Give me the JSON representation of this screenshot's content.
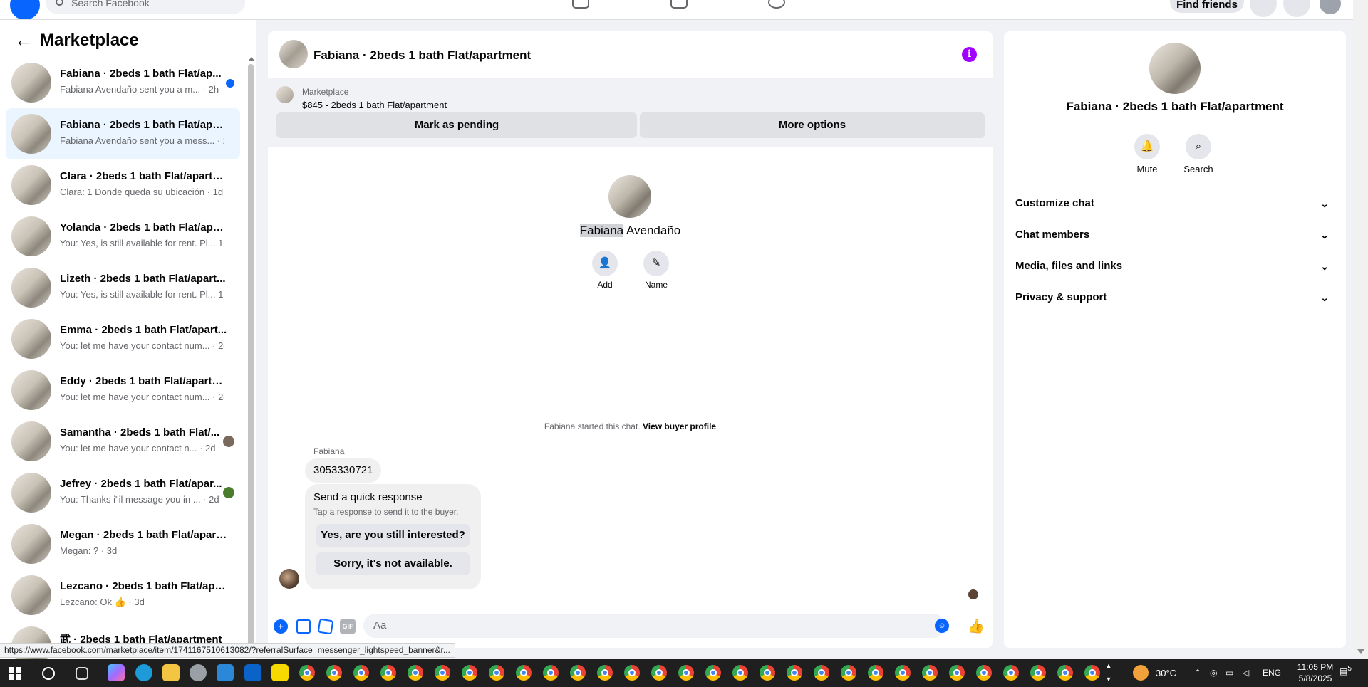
{
  "topbar": {
    "search_placeholder": "Search Facebook",
    "find_friends": "Find friends"
  },
  "sidebar": {
    "title": "Marketplace",
    "conversations": [
      {
        "name": "Fabiana · 2beds 1 bath Flat/ap...",
        "preview": "Fabiana Avendaño sent you a m... · 2h",
        "unread": true,
        "active": false
      },
      {
        "name": "Fabiana · 2beds 1 bath Flat/apar...",
        "preview": "Fabiana Avendaño sent you a mess... · 2h",
        "unread": false,
        "active": true
      },
      {
        "name": "Clara · 2beds 1 bath Flat/apartm...",
        "preview": "Clara: 1 Donde queda su ubicación · 1d",
        "unread": false,
        "active": false
      },
      {
        "name": "Yolanda · 2beds 1 bath Flat/apar...",
        "preview": "You: Yes, is still available for rent. Pl...  1d",
        "unread": false,
        "active": false
      },
      {
        "name": "Lizeth · 2beds 1 bath Flat/apart...",
        "preview": "You: Yes, is still available for rent. Pl...  1d",
        "unread": false,
        "active": false
      },
      {
        "name": "Emma · 2beds 1 bath Flat/apart...",
        "preview": "You: let me have your contact num... · 2d",
        "unread": false,
        "active": false
      },
      {
        "name": "Eddy · 2beds 1 bath Flat/apartm...",
        "preview": "You: let me have your contact num... · 2d",
        "unread": false,
        "active": false
      },
      {
        "name": "Samantha · 2beds 1 bath Flat/...",
        "preview": "You: let me have your contact n... · 2d",
        "unread": false,
        "active": false
      },
      {
        "name": "Jefrey · 2beds 1 bath Flat/apar...",
        "preview": "You: Thanks i\"il message you in ... · 2d",
        "unread": false,
        "active": false
      },
      {
        "name": "Megan · 2beds 1 bath Flat/apart...",
        "preview": "Megan: ? · 3d",
        "unread": false,
        "active": false
      },
      {
        "name": "Lezcano · 2beds 1 bath Flat/apar...",
        "preview": "Lezcano: Ok 👍 · 3d",
        "unread": false,
        "active": false
      },
      {
        "name": "武 · 2beds 1 bath Flat/apartment",
        "preview": "",
        "unread": false,
        "active": false
      }
    ]
  },
  "chat": {
    "title": "Fabiana · 2beds 1 bath Flat/apartment",
    "listing": {
      "source": "Marketplace",
      "price_title": "$845 - 2beds 1 bath Flat/apartment",
      "mark_pending": "Mark as pending",
      "more_options": "More options"
    },
    "profile": {
      "first_name": "Fabiana",
      "last_name": " Avendaño",
      "add_label": "Add",
      "name_label": "Name"
    },
    "started_text": "Fabiana started this chat. ",
    "view_profile": "View buyer profile",
    "sender_name": "Fabiana",
    "message": "3053330721",
    "quick_response": {
      "title": "Send a quick response",
      "subtitle": "Tap a response to send it to the buyer.",
      "options": [
        "Yes, are you still interested?",
        "Sorry, it's not available."
      ]
    },
    "composer_placeholder": "Aa"
  },
  "info_panel": {
    "title": "Fabiana · 2beds 1 bath Flat/apartment",
    "mute": "Mute",
    "search": "Search",
    "sections": [
      "Customize chat",
      "Chat members",
      "Media, files and links",
      "Privacy & support"
    ]
  },
  "statusbar": {
    "url": "https://www.facebook.com/marketplace/item/1741167510613082/?referralSurface=messenger_lightspeed_banner&r..."
  },
  "taskbar": {
    "temperature": "30°C",
    "language": "ENG",
    "time": "11:05 PM",
    "date": "5/8/2025",
    "notifications": "5"
  },
  "colors": {
    "brand_blue": "#0866ff",
    "active_conv": "#ebf5ff",
    "info_purple": "#a100ff"
  }
}
